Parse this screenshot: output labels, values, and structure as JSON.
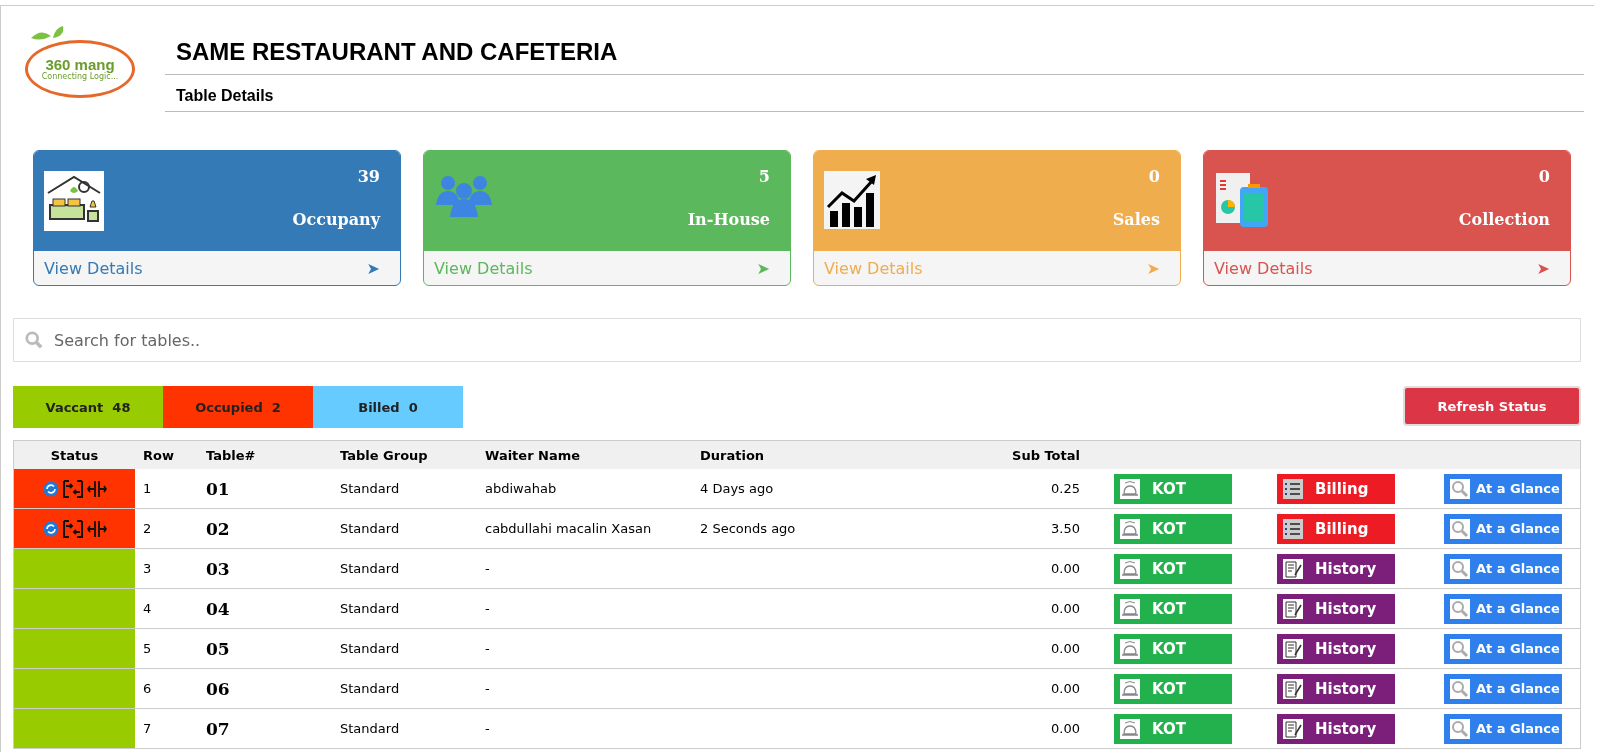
{
  "logo": {
    "text": "360 mang",
    "tagline": "Connecting Logic..."
  },
  "header": {
    "title": "SAME RESTAURANT AND CAFETERIA",
    "subtitle": "Table Details"
  },
  "cards": [
    {
      "kind": "occupancy",
      "value": "39",
      "label": "Occupany",
      "link": "View Details",
      "arrow": "➤",
      "color": "#337ab7"
    },
    {
      "kind": "inhouse",
      "value": "5",
      "label": "In-House",
      "link": "View Details",
      "arrow": "➤",
      "color": "#5cb85c"
    },
    {
      "kind": "sales",
      "value": "0",
      "label": "Sales",
      "link": "View Details",
      "arrow": "➤",
      "color": "#f0ad4e"
    },
    {
      "kind": "collection",
      "value": "0",
      "label": "Collection",
      "link": "View Details",
      "arrow": "➤",
      "color": "#d9534f"
    }
  ],
  "search": {
    "placeholder": "Search for tables.."
  },
  "filters": [
    {
      "label": "Vaccant  48",
      "color": "#99cc00"
    },
    {
      "label": "Occupied  2",
      "color": "#ff3300"
    },
    {
      "label": "Billed  0",
      "color": "#66ccff"
    }
  ],
  "refresh_button": "Refresh Status",
  "table": {
    "columns": [
      "Status",
      "Row",
      "Table#",
      "Table Group",
      "Waiter Name",
      "Duration",
      "Sub Total"
    ],
    "rows": [
      {
        "occupied": true,
        "row": "1",
        "table": "01",
        "group": "Standard",
        "waiter": "abdiwahab",
        "duration": "4 Days ago",
        "subtotal": "0.25",
        "kot": "KOT",
        "action": {
          "kind": "billing",
          "label": "Billing"
        },
        "glance": "At a Glance"
      },
      {
        "occupied": true,
        "row": "2",
        "table": "02",
        "group": "Standard",
        "waiter": "cabdullahi macalin Xasan",
        "duration": "2 Seconds ago",
        "subtotal": "3.50",
        "kot": "KOT",
        "action": {
          "kind": "billing",
          "label": "Billing"
        },
        "glance": "At a Glance"
      },
      {
        "occupied": false,
        "row": "3",
        "table": "03",
        "group": "Standard",
        "waiter": "-",
        "subtotal": "0.00",
        "kot": "KOT",
        "action": {
          "kind": "history",
          "label": "History"
        },
        "glance": "At a Glance"
      },
      {
        "occupied": false,
        "row": "4",
        "table": "04",
        "group": "Standard",
        "waiter": "-",
        "subtotal": "0.00",
        "kot": "KOT",
        "action": {
          "kind": "history",
          "label": "History"
        },
        "glance": "At a Glance"
      },
      {
        "occupied": false,
        "row": "5",
        "table": "05",
        "group": "Standard",
        "waiter": "-",
        "subtotal": "0.00",
        "kot": "KOT",
        "action": {
          "kind": "history",
          "label": "History"
        },
        "glance": "At a Glance"
      },
      {
        "occupied": false,
        "row": "6",
        "table": "06",
        "group": "Standard",
        "waiter": "-",
        "subtotal": "0.00",
        "kot": "KOT",
        "action": {
          "kind": "history",
          "label": "History"
        },
        "glance": "At a Glance"
      },
      {
        "occupied": false,
        "row": "7",
        "table": "07",
        "group": "Standard",
        "waiter": "-",
        "subtotal": "0.00",
        "kot": "KOT",
        "action": {
          "kind": "history",
          "label": "History"
        },
        "glance": "At a Glance"
      }
    ]
  }
}
